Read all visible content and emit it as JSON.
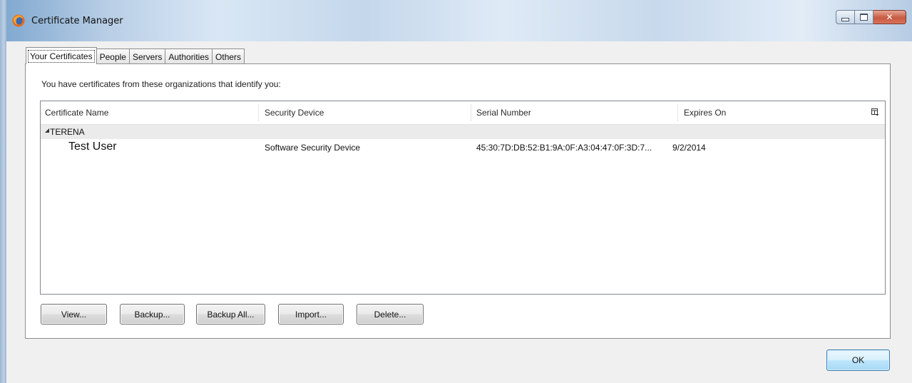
{
  "window": {
    "title": "Certificate Manager",
    "icon": "firefox-icon"
  },
  "tabs": [
    {
      "label": "Your Certificates",
      "active": true
    },
    {
      "label": "People",
      "active": false
    },
    {
      "label": "Servers",
      "active": false
    },
    {
      "label": "Authorities",
      "active": false
    },
    {
      "label": "Others",
      "active": false
    }
  ],
  "panel": {
    "description": "You have certificates from these organizations that identify you:"
  },
  "tree": {
    "columns": [
      "Certificate Name",
      "Security Device",
      "Serial Number",
      "Expires On"
    ],
    "column_picker_icon": "column-picker-icon",
    "groups": [
      {
        "name": "TERENA",
        "expanded": true,
        "rows": [
          {
            "name": "Test User",
            "device": "Software Security Device",
            "serial": "45:30:7D:DB:52:B1:9A:0F:A3:04:47:0F:3D:7...",
            "expires": "9/2/2014"
          }
        ]
      }
    ]
  },
  "buttons": {
    "view": "View...",
    "backup": "Backup...",
    "backup_all": "Backup All...",
    "import": "Import...",
    "delete": "Delete...",
    "ok": "OK"
  },
  "colors": {
    "ok_border": "#3c7fb1",
    "close_button": "#c75a42",
    "group_row_bg": "#ebebeb"
  }
}
